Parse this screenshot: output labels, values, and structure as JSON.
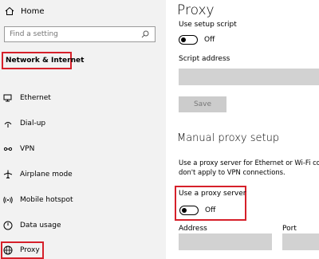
{
  "sidebar": {
    "home_label": "Home",
    "search_placeholder": "Find a setting",
    "section_title": "Network & Internet",
    "items": [
      {
        "label": "Ethernet",
        "icon": "monitor-icon"
      },
      {
        "label": "Dial-up",
        "icon": "phone-icon"
      },
      {
        "label": "VPN",
        "icon": "vpn-icon"
      },
      {
        "label": "Airplane mode",
        "icon": "airplane-icon"
      },
      {
        "label": "Mobile hotspot",
        "icon": "hotspot-icon"
      },
      {
        "label": "Data usage",
        "icon": "gauge-icon"
      },
      {
        "label": "Proxy",
        "icon": "globe-icon"
      }
    ]
  },
  "main": {
    "title": "Proxy",
    "auto": {
      "setup_script_label": "Use setup script",
      "setup_script_state": "Off",
      "script_address_label": "Script address",
      "save_label": "Save"
    },
    "manual": {
      "heading": "Manual proxy setup",
      "desc_line1": "Use a proxy server for Ethernet or Wi-Fi conn",
      "desc_line2": "don't apply to VPN connections.",
      "use_proxy_label": "Use a proxy server",
      "use_proxy_state": "Off",
      "address_label": "Address",
      "port_label": "Port"
    }
  },
  "colors": {
    "highlight": "#d6202a",
    "sidebar_bg": "#f2f2f2",
    "field": "#d2d2d2"
  }
}
